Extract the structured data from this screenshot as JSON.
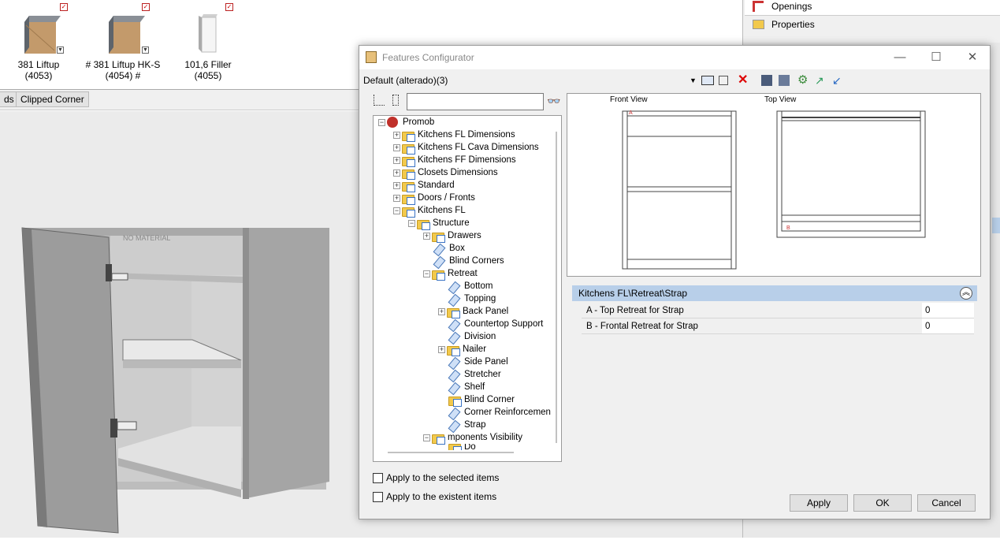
{
  "catalog": {
    "items": [
      {
        "label": "381 Liftup (4053)"
      },
      {
        "label": "# 381 Liftup HK-S (4054) #"
      },
      {
        "label": "101,6 Filler (4055)"
      }
    ]
  },
  "tabs": {
    "partial": "ds",
    "clipped_corner": "Clipped Corner"
  },
  "scene_labels": {
    "no_material": "NO MATERIAL"
  },
  "right_panel": {
    "openings": "Openings",
    "properties": "Properties"
  },
  "dialog": {
    "title": "Features Configurator",
    "config_name": "Default (alterado)(3)",
    "search_value": "",
    "tree": [
      {
        "label": "Promob"
      },
      {
        "label": "Kitchens FL Dimensions"
      },
      {
        "label": "Kitchens FL Cava Dimensions"
      },
      {
        "label": "Kitchens FF Dimensions"
      },
      {
        "label": "Closets Dimensions"
      },
      {
        "label": "Standard"
      },
      {
        "label": "Doors / Fronts"
      },
      {
        "label": "Kitchens FL"
      },
      {
        "label": "Structure"
      },
      {
        "label": "Drawers"
      },
      {
        "label": "Box"
      },
      {
        "label": "Blind Corners"
      },
      {
        "label": "Retreat"
      },
      {
        "label": "Bottom"
      },
      {
        "label": "Topping"
      },
      {
        "label": "Back Panel"
      },
      {
        "label": "Countertop Support"
      },
      {
        "label": "Division"
      },
      {
        "label": "Nailer"
      },
      {
        "label": "Side Panel"
      },
      {
        "label": "Stretcher"
      },
      {
        "label": "Shelf"
      },
      {
        "label": "Blind Corner"
      },
      {
        "label": "Corner Reinforcemen"
      },
      {
        "label": "Strap"
      },
      {
        "label": "mponents Visibility"
      },
      {
        "label": "Do"
      }
    ],
    "preview": {
      "front_view": "Front View",
      "top_view": "Top View",
      "marker_a": "A",
      "marker_b": "B"
    },
    "grid": {
      "header": "Kitchens FL\\Retreat\\Strap",
      "rows": [
        {
          "label": "A - Top Retreat for Strap",
          "value": "0"
        },
        {
          "label": "B - Frontal Retreat for Strap",
          "value": "0"
        }
      ]
    },
    "checkboxes": {
      "apply_selected": "Apply to the selected items",
      "apply_existent": "Apply to the existent items"
    },
    "buttons": {
      "apply": "Apply",
      "ok": "OK",
      "cancel": "Cancel"
    }
  },
  "colors": {
    "accent": "#b8cfe9",
    "annotation_arrow": "#e8121b"
  }
}
